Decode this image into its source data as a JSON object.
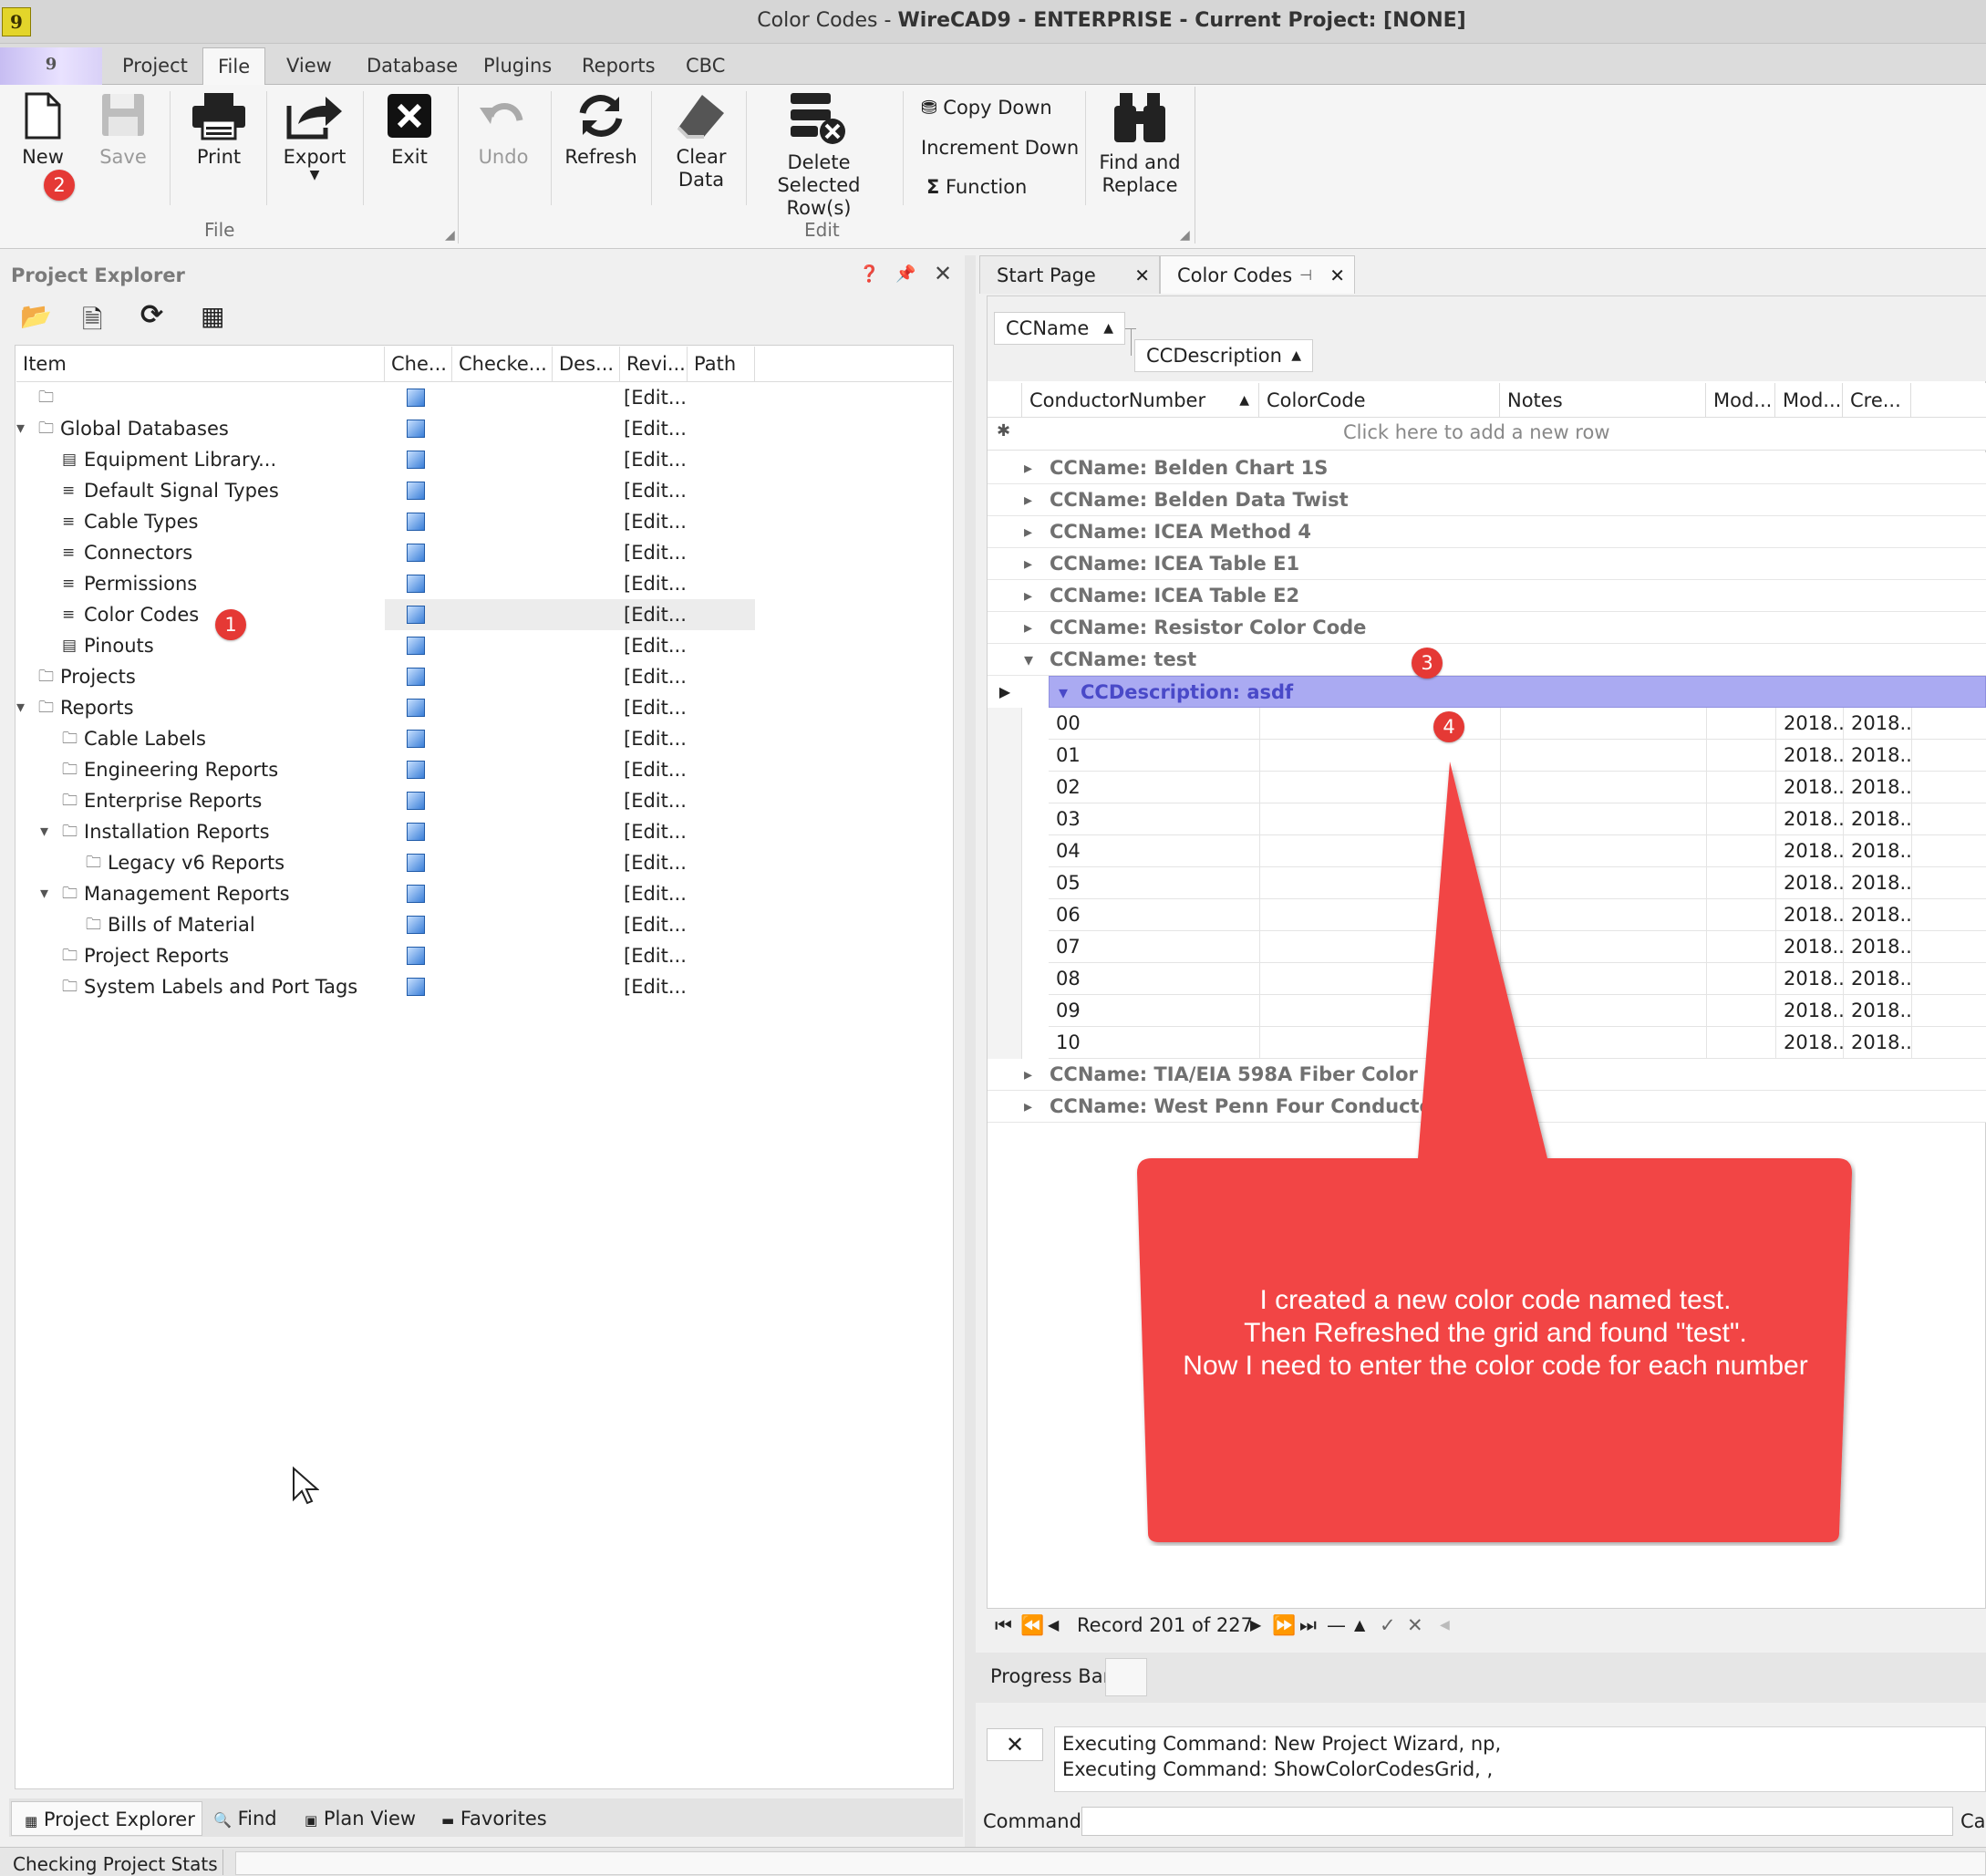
{
  "window": {
    "title_prefix": "Color Codes - ",
    "title_bold": "WireCAD9 - ENTERPRISE - Current Project: [NONE]",
    "app_logo": "9"
  },
  "menu": {
    "app_button": "9",
    "tabs": [
      "Project",
      "File",
      "View",
      "Database",
      "Plugins",
      "Reports",
      "CBC"
    ],
    "active_tab": "File"
  },
  "ribbon": {
    "file_group": {
      "label": "File",
      "new": "New",
      "save": "Save",
      "print": "Print",
      "export": "Export",
      "exit": "Exit"
    },
    "edit_group": {
      "label": "Edit",
      "undo": "Undo",
      "refresh": "Refresh",
      "clear_data_1": "Clear",
      "clear_data_2": "Data",
      "delete_1": "Delete Selected",
      "delete_2": "Row(s)",
      "copy_down": "Copy Down",
      "increment_down": "Increment Down",
      "function": "Function",
      "find_1": "Find and",
      "find_2": "Replace"
    }
  },
  "project_explorer": {
    "title": "Project Explorer",
    "columns": [
      "Item",
      "Che...",
      "Checke...",
      "Des...",
      "Revi...",
      "Path"
    ],
    "edit_text": "[Edit...",
    "rows": [
      {
        "label": "",
        "level": 0,
        "expander": "",
        "icon": "folder"
      },
      {
        "label": "Global Databases",
        "level": 0,
        "expander": "open",
        "icon": "folder"
      },
      {
        "label": "Equipment Library...",
        "level": 1,
        "expander": "",
        "icon": "chip"
      },
      {
        "label": "Default Signal Types",
        "level": 1,
        "expander": "",
        "icon": "list"
      },
      {
        "label": "Cable Types",
        "level": 1,
        "expander": "",
        "icon": "list"
      },
      {
        "label": "Connectors",
        "level": 1,
        "expander": "",
        "icon": "list"
      },
      {
        "label": "Permissions",
        "level": 1,
        "expander": "",
        "icon": "list"
      },
      {
        "label": "Color Codes",
        "level": 1,
        "expander": "",
        "icon": "list"
      },
      {
        "label": "Pinouts",
        "level": 1,
        "expander": "",
        "icon": "pin"
      },
      {
        "label": "Projects",
        "level": 0,
        "expander": "",
        "icon": "folder"
      },
      {
        "label": "Reports",
        "level": 0,
        "expander": "open",
        "icon": "folder"
      },
      {
        "label": "Cable Labels",
        "level": 1,
        "expander": "",
        "icon": "folder"
      },
      {
        "label": "Engineering Reports",
        "level": 1,
        "expander": "",
        "icon": "folder"
      },
      {
        "label": "Enterprise Reports",
        "level": 1,
        "expander": "",
        "icon": "folder"
      },
      {
        "label": "Installation Reports",
        "level": 1,
        "expander": "open",
        "icon": "folder"
      },
      {
        "label": "Legacy v6 Reports",
        "level": 2,
        "expander": "",
        "icon": "folder"
      },
      {
        "label": "Management Reports",
        "level": 1,
        "expander": "open",
        "icon": "folder"
      },
      {
        "label": "Bills of Material",
        "level": 2,
        "expander": "",
        "icon": "folder"
      },
      {
        "label": "Project Reports",
        "level": 1,
        "expander": "",
        "icon": "folder"
      },
      {
        "label": "System Labels and Port Tags",
        "level": 1,
        "expander": "",
        "icon": "folder"
      }
    ],
    "bottom_tabs": [
      "Project Explorer",
      "Find",
      "Plan View",
      "Favorites"
    ]
  },
  "documents": {
    "tabs": [
      "Start Page",
      "Color Codes"
    ],
    "active": "Color Codes"
  },
  "grid": {
    "group_by": [
      "CCName",
      "CCDescription"
    ],
    "columns": [
      "ConductorNumber",
      "ColorCode",
      "Notes",
      "Mod...",
      "Mod...",
      "Cre..."
    ],
    "new_row_text": "Click here to add a new row",
    "groups_before": [
      "CCName: Belden Chart 1S",
      "CCName: Belden Data Twist",
      "CCName: ICEA Method 4",
      "CCName: ICEA Table E1",
      "CCName: ICEA Table E2",
      "CCName: Resistor Color Code"
    ],
    "open_group": "CCName: test",
    "sub_group": "CCDescription: asdf",
    "rows": [
      {
        "n": "00",
        "mod": "2018...",
        "cre": "2018..."
      },
      {
        "n": "01",
        "mod": "2018...",
        "cre": "2018..."
      },
      {
        "n": "02",
        "mod": "2018...",
        "cre": "2018..."
      },
      {
        "n": "03",
        "mod": "2018...",
        "cre": "2018..."
      },
      {
        "n": "04",
        "mod": "2018...",
        "cre": "2018..."
      },
      {
        "n": "05",
        "mod": "2018...",
        "cre": "2018..."
      },
      {
        "n": "06",
        "mod": "2018...",
        "cre": "2018..."
      },
      {
        "n": "07",
        "mod": "2018...",
        "cre": "2018..."
      },
      {
        "n": "08",
        "mod": "2018...",
        "cre": "2018..."
      },
      {
        "n": "09",
        "mod": "2018...",
        "cre": "2018..."
      },
      {
        "n": "10",
        "mod": "2018...",
        "cre": "2018..."
      }
    ],
    "groups_after": [
      "CCName: TIA/EIA 598A Fiber Color Cod",
      "CCName: West Penn Four Conductor"
    ],
    "record_text": "Record 201 of 227"
  },
  "annotation": {
    "badges": [
      "1",
      "2",
      "3",
      "4"
    ],
    "callout_text": "I created a new color code named test.\nThen Refreshed the grid and found \"test\".\nNow I need to enter the color code for each number",
    "color": "#f24545"
  },
  "progress": {
    "label": "Progress Bar"
  },
  "command": {
    "log": [
      "Executing Command: New Project Wizard, np,",
      "Executing Command: ShowColorCodesGrid, ,"
    ],
    "label": "Command:",
    "value": "",
    "cut_button": "Cal"
  },
  "status": {
    "text": "Checking Project Stats"
  }
}
